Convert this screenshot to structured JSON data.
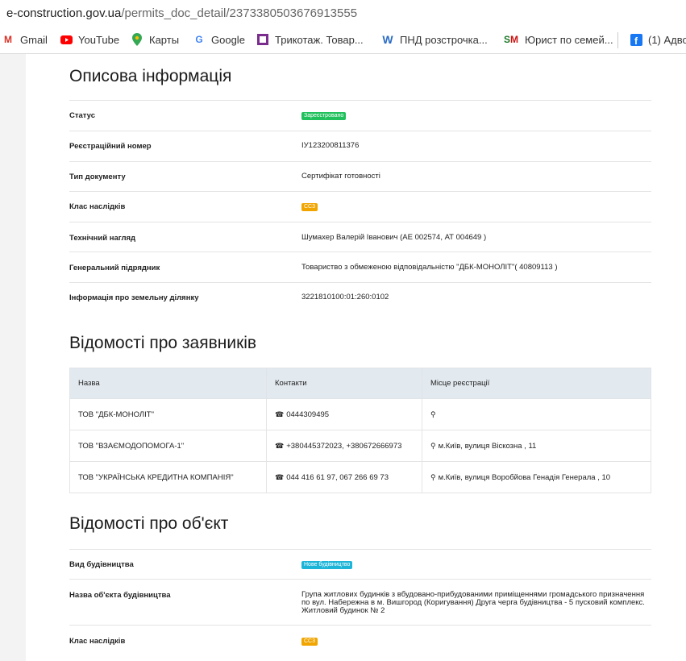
{
  "browser": {
    "url_host": "e-construction.gov.ua",
    "url_path": "/permits_doc_detail/2373380503676913555",
    "bookmarks": [
      {
        "label": "Gmail",
        "icon": "gmail-icon"
      },
      {
        "label": "YouTube",
        "icon": "youtube-icon"
      },
      {
        "label": "Карты",
        "icon": "maps-icon"
      },
      {
        "label": "Google",
        "icon": "google-icon"
      },
      {
        "label": "Трикотаж. Товар...",
        "icon": "purple-square-icon"
      },
      {
        "label": "ПНД розстрочка...",
        "icon": "w-icon"
      },
      {
        "label": "Юрист по семей...",
        "icon": "sm-icon"
      },
      {
        "label": "(1) Адво",
        "icon": "facebook-icon"
      }
    ]
  },
  "section1": {
    "title": "Описова інформація",
    "rows": [
      {
        "key": "Статус",
        "value": "Зареєстровано",
        "badge": "green"
      },
      {
        "key": "Реєстраційний номер",
        "value": "ІУ123200811376"
      },
      {
        "key": "Тип документу",
        "value": "Сертифікат готовності"
      },
      {
        "key": "Клас наслідків",
        "value": "СС3",
        "badge": "orange"
      },
      {
        "key": "Технічний нагляд",
        "value": "Шумахер Валерій Іванович (АЕ 002574, АТ 004649 )"
      },
      {
        "key": "Генеральний підрядник",
        "value": "Товариство з обмеженою відповідальністю \"ДБК-МОНОЛІТ\"( 40809113 )"
      },
      {
        "key": "Інформація про земельну ділянку",
        "value": "3221810100:01:260:0102"
      }
    ]
  },
  "section2": {
    "title": "Відомості про заявників",
    "headers": [
      "Назва",
      "Контакти",
      "Місце реєстрації"
    ],
    "rows": [
      {
        "name": "ТОВ \"ДБК-МОНОЛІТ\"",
        "contacts": "0444309495",
        "place": ""
      },
      {
        "name": "ТОВ \"ВЗАЄМОДОПОМОГА-1\"",
        "contacts": "+380445372023, +380672666973",
        "place": "м.Київ, вулиця Віскозна , 11"
      },
      {
        "name": "ТОВ \"УКРАЇНСЬКА КРЕДИТНА КОМПАНІЯ\"",
        "contacts": "044 416 61 97, 067 266 69 73",
        "place": "м.Київ, вулиця Воробйова Генадія Генерала , 10"
      }
    ]
  },
  "section3": {
    "title": "Відомості про об'єкт",
    "rows": [
      {
        "key": "Вид будівництва",
        "value": "Нове будівництво",
        "badge": "cyan"
      },
      {
        "key": "Назва об'єкта будівництва",
        "value": "Група житлових будинків з вбудовано-прибудованими приміщеннями громадського призначення по вул. Набережна в м. Вишгород (Коригування) Друга черга будівництва - 5 пусковий комплекс. Житловий будинок № 2"
      },
      {
        "key": "Клас наслідків",
        "value": "СС3",
        "badge": "orange"
      }
    ]
  },
  "colors": {
    "green": "#20c05c",
    "orange": "#f0a500",
    "cyan": "#1cb5d8",
    "table_header": "#e2e9ef"
  }
}
